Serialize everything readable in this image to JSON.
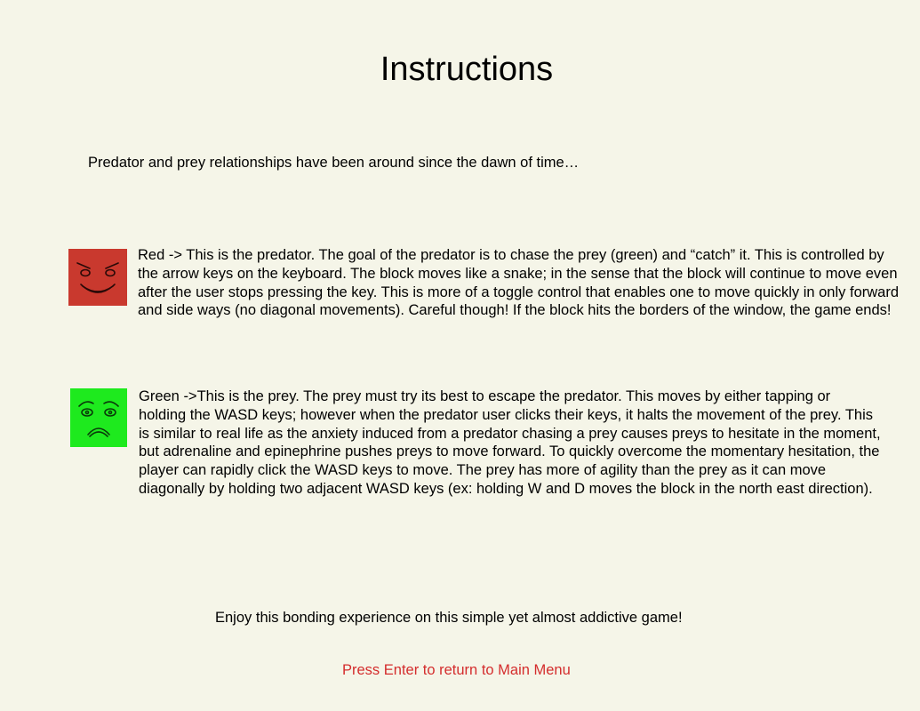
{
  "screen": {
    "title": "Instructions",
    "intro": "Predator and prey relationships have been around since the dawn of time…",
    "predator": {
      "icon": "angry-red-block-icon",
      "color": "#c9392e",
      "description": "Red -> This is the predator. The goal of the predator is to chase the prey (green) and “catch” it. This is controlled by the arrow keys on the keyboard. The block moves like a snake; in the sense that the block will continue to move even after the user stops pressing the key. This is more of a toggle control that enables one to move quickly in only forward and side ways (no diagonal movements). Careful though! If the block hits the borders of the window, the game ends!"
    },
    "prey": {
      "icon": "worried-green-block-icon",
      "color": "#1eea1e",
      "description": "Green ->This is the prey. The prey must try its best to escape the predator. This moves by either tapping or holding the WASD keys; however when the predator user clicks their keys, it halts the movement of the prey. This is similar to real life as the anxiety induced from a predator chasing a prey causes preys to hesitate in the moment, but adrenaline and epinephrine pushes preys to move forward. To quickly overcome the momentary hesitation, the player can rapidly click the WASD keys to move. The prey has more of agility than the prey as it can move diagonally by holding two adjacent WASD keys (ex: holding W and D moves the block in the north east direction)."
    },
    "closing": "Enjoy this bonding experience on this simple yet almost addictive game!",
    "return_prompt": "Press Enter to return to Main Menu",
    "prompt_color": "#d42d2d",
    "background_color": "#f5f5e8"
  }
}
